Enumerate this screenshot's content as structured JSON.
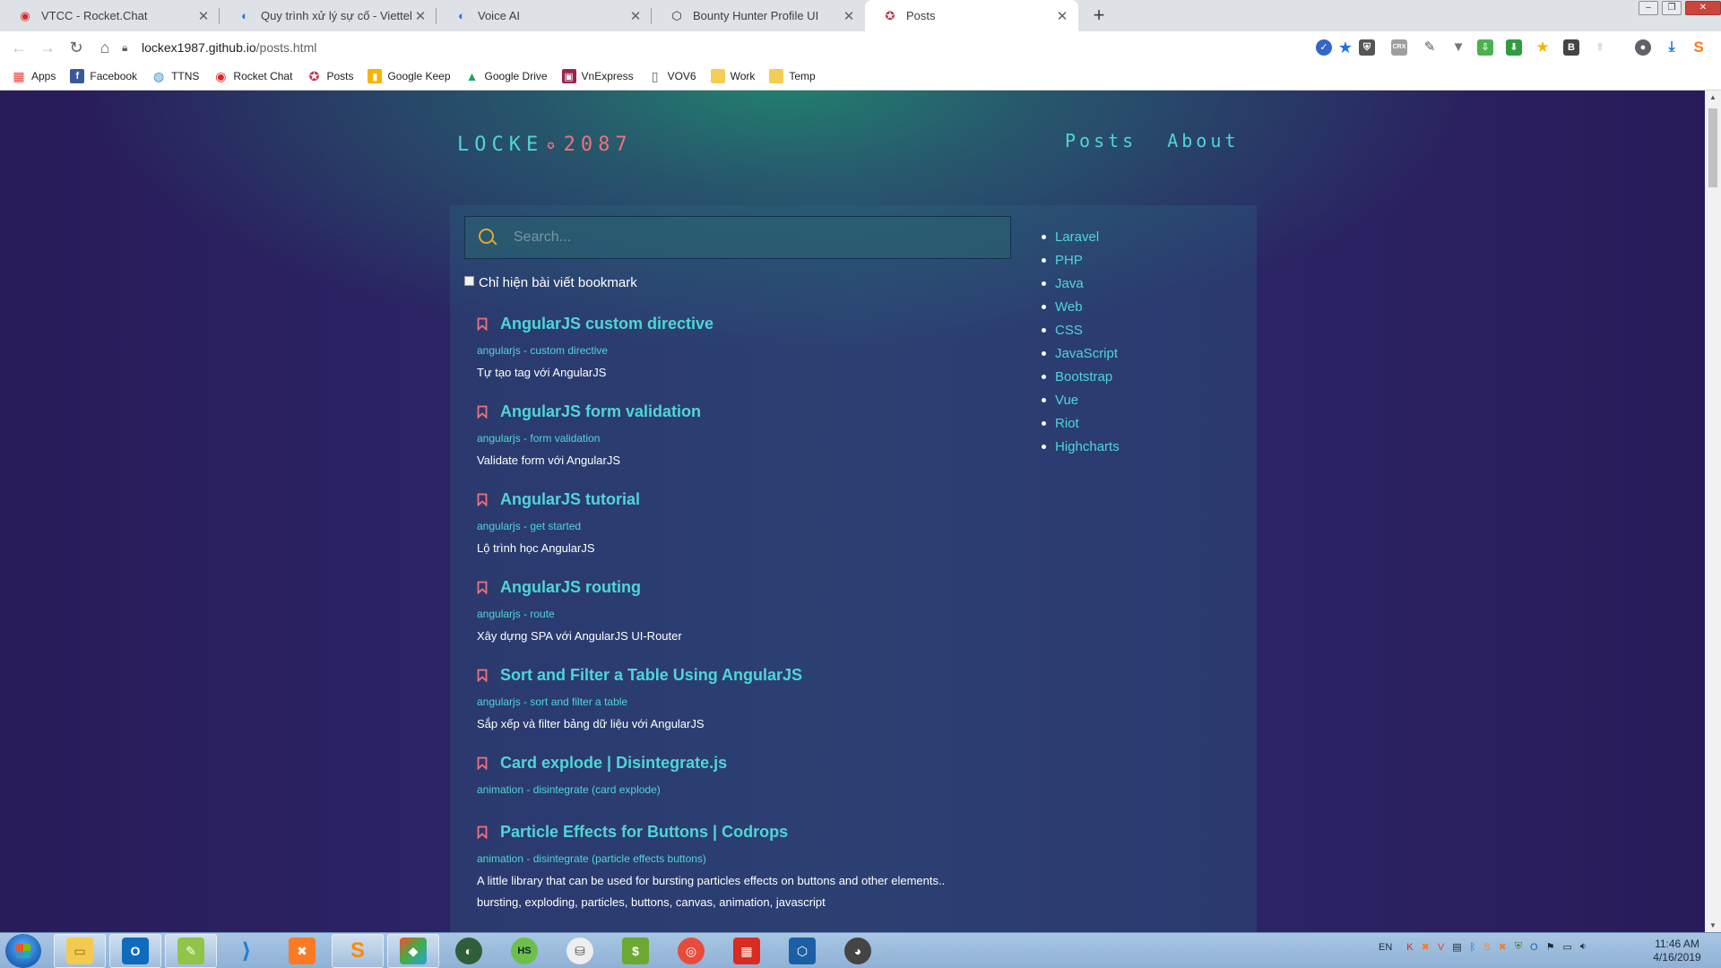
{
  "browser": {
    "tabs": [
      {
        "title": "VTCC - Rocket.Chat",
        "icon": "rocketchat-icon",
        "active": false
      },
      {
        "title": "Quy trình xử lý sự cố - Viettel Cyb",
        "icon": "google-docs-icon",
        "active": false
      },
      {
        "title": "Voice AI",
        "icon": "google-docs-icon",
        "active": false
      },
      {
        "title": "Bounty Hunter Profile UI",
        "icon": "codepen-icon",
        "active": false
      },
      {
        "title": "Posts",
        "icon": "locke-icon",
        "active": true
      }
    ],
    "address": {
      "host": "lockex1987.github.io",
      "path": "/posts.html"
    },
    "bookmarks": [
      {
        "label": "Apps",
        "icon": "apps-grid-icon",
        "color": "#e94235"
      },
      {
        "label": "Facebook",
        "icon": "facebook-icon",
        "color": "#3b5998"
      },
      {
        "label": "TTNS",
        "icon": "globe-icon",
        "color": "#3a8fc7"
      },
      {
        "label": "Rocket Chat",
        "icon": "rocketchat-icon",
        "color": "#db2323"
      },
      {
        "label": "Posts",
        "icon": "locke-icon",
        "color": "#c2334b"
      },
      {
        "label": "Google Keep",
        "icon": "google-keep-icon",
        "color": "#f6b400"
      },
      {
        "label": "Google Drive",
        "icon": "google-drive-icon",
        "color": "#1fa463"
      },
      {
        "label": "VnExpress",
        "icon": "vnexpress-icon",
        "color": "#9f224e"
      },
      {
        "label": "VOV6",
        "icon": "page-icon",
        "color": "#ffffff"
      },
      {
        "label": "Work",
        "icon": "folder-icon",
        "color": "#f5cd53"
      },
      {
        "label": "Temp",
        "icon": "folder-icon",
        "color": "#f5cd53"
      }
    ]
  },
  "site": {
    "brand_left": "LOCKE",
    "brand_right": "2087",
    "nav": [
      "Posts",
      "About"
    ],
    "accent": "#4fd6d6",
    "accent_warm": "#f0717b"
  },
  "search": {
    "placeholder": "Search..."
  },
  "bookmark_filter": {
    "label": "Chỉ hiện bài viết bookmark",
    "checked": false
  },
  "posts": [
    {
      "title": "AngularJS custom directive",
      "tags": "angularjs - custom directive",
      "desc": [
        "Tự tạo tag với AngularJS"
      ]
    },
    {
      "title": "AngularJS form validation",
      "tags": "angularjs - form validation",
      "desc": [
        "Validate form với AngularJS"
      ]
    },
    {
      "title": "AngularJS tutorial",
      "tags": "angularjs - get started",
      "desc": [
        "Lộ trình học AngularJS"
      ]
    },
    {
      "title": "AngularJS routing",
      "tags": "angularjs - route",
      "desc": [
        "Xây dựng SPA với AngularJS UI-Router"
      ]
    },
    {
      "title": "Sort and Filter a Table Using AngularJS",
      "tags": "angularjs - sort and filter a table",
      "desc": [
        "Sắp xếp và filter bảng dữ liệu với AngularJS"
      ]
    },
    {
      "title": "Card explode | Disintegrate.js",
      "tags": "animation - disintegrate (card explode)",
      "desc": []
    },
    {
      "title": "Particle Effects for Buttons | Codrops",
      "tags": "animation - disintegrate (particle effects buttons)",
      "desc": [
        "A little library that can be used for bursting particles effects on buttons and other elements..",
        "bursting, exploding, particles, buttons, canvas, animation, javascript"
      ]
    }
  ],
  "categories": [
    "Laravel",
    "PHP",
    "Java",
    "Web",
    "CSS",
    "JavaScript",
    "Bootstrap",
    "Vue",
    "Riot",
    "Highcharts"
  ],
  "taskbar": {
    "apps": [
      "windows-explorer-icon",
      "outlook-icon",
      "notepad-icon",
      "vscode-icon",
      "xampp-icon",
      "sublime-icon",
      "git-icon",
      "android-icon",
      "heidisql-icon",
      "db-icon",
      "money-icon",
      "redis-icon",
      "cube-icon",
      "virtualbox-icon",
      "mask-icon"
    ],
    "lang": "EN",
    "time": "11:46 AM",
    "date": "4/16/2019"
  }
}
